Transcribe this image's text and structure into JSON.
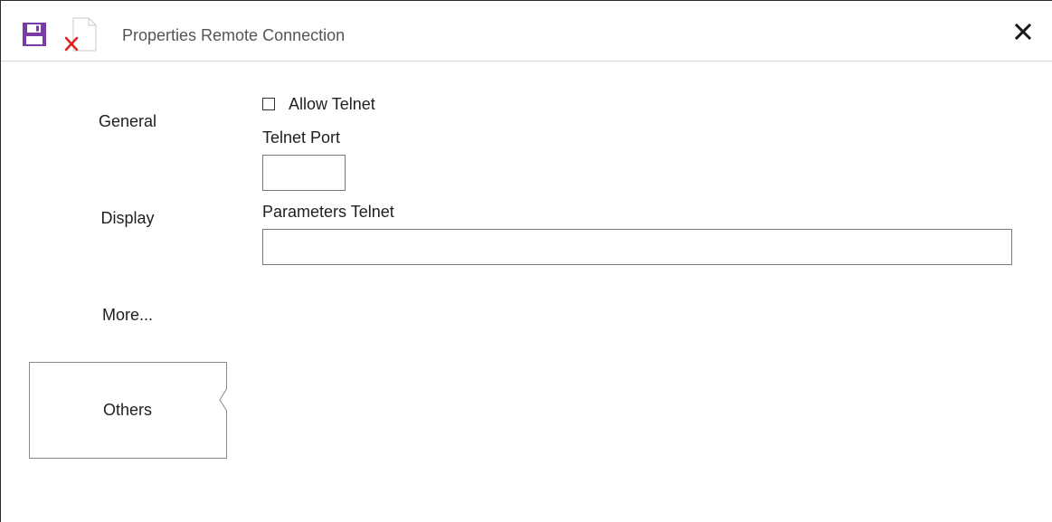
{
  "window": {
    "title": "Properties Remote Connection"
  },
  "toolbar": {
    "save_icon": "floppy-disk-icon",
    "delete_icon": "document-delete-icon",
    "close_icon": "close-icon"
  },
  "colors": {
    "save_icon": "#7a3aa8",
    "delete_icon": "#e02020",
    "divider": "#d9d9d9",
    "selected_border": "#8a8a8a"
  },
  "nav": {
    "items": [
      {
        "label": "General",
        "selected": false
      },
      {
        "label": "Display",
        "selected": false
      },
      {
        "label": "More...",
        "selected": false
      },
      {
        "label": "Others",
        "selected": true
      }
    ]
  },
  "form": {
    "allow_telnet": {
      "label": "Allow Telnet",
      "checked": false
    },
    "telnet_port": {
      "label": "Telnet Port",
      "value": ""
    },
    "parameters_telnet": {
      "label": "Parameters Telnet",
      "value": ""
    }
  }
}
